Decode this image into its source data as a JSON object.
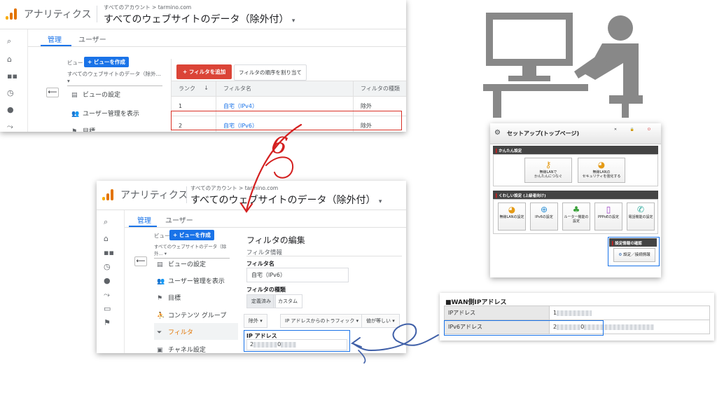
{
  "ga1": {
    "app_title": "アナリティクス",
    "account": "すべてのアカウント > tarmino.com",
    "property": "すべてのウェブサイトのデータ（除外付）",
    "tabs": [
      "管理",
      "ユーザー"
    ],
    "view_label": "ビュー",
    "create_view": "+ ビューを作成",
    "view_select": "すべてのウェブサイトのデータ（除外...",
    "menu": [
      {
        "icon": "file-icon",
        "label": "ビューの設定"
      },
      {
        "icon": "users-icon",
        "label": "ユーザー管理を表示"
      },
      {
        "icon": "flag-icon",
        "label": "目標"
      }
    ],
    "add_filter": "+ フィルタを追加",
    "reorder": "フィルタの順序を割り当て",
    "table": {
      "headers": [
        "ランク",
        "フィルタ名",
        "フィルタの種類"
      ],
      "rows": [
        [
          "1",
          "自宅（IPv4）",
          "除外"
        ],
        [
          "2",
          "自宅（IPv6）",
          "除外"
        ]
      ]
    }
  },
  "ga2": {
    "app_title": "アナリティクス",
    "account": "すべてのアカウント > tarmino.com",
    "property": "すべてのウェブサイトのデータ（除外付）",
    "tabs": [
      "管理",
      "ユーザー"
    ],
    "view_label": "ビュー",
    "create_view": "+ ビューを作成",
    "view_select": "すべてのウェブサイトのデータ（除外...",
    "menu": [
      {
        "icon": "file-icon",
        "label": "ビューの設定"
      },
      {
        "icon": "users-icon",
        "label": "ユーザー管理を表示"
      },
      {
        "icon": "flag-icon",
        "label": "目標"
      },
      {
        "icon": "person-icon",
        "label": "コンテンツ グループ"
      },
      {
        "icon": "filter-icon",
        "label": "フィルタ"
      },
      {
        "icon": "channel-icon",
        "label": "チャネル設定"
      }
    ],
    "edit_title": "フィルタの編集",
    "info_title": "フィルタ情報",
    "filter_name_label": "フィルタ名",
    "filter_name_value": "自宅（IPv6）",
    "filter_type_label": "フィルタの種類",
    "type_tabs": [
      "定義済み",
      "カスタム"
    ],
    "dropdowns": [
      "除外",
      "IP アドレスからのトラフィック",
      "値が等しい"
    ],
    "ip_label": "IP アドレス",
    "ip_value_start": "2",
    "ip_value_mid": "0"
  },
  "annotation_number": "6",
  "router": {
    "title": "セットアップ(トップページ)",
    "section_easy": "かんたん設定",
    "easy_buttons": [
      "無線LANで\nかんたんにつなぐ",
      "無線LANの\nセキュリティを強化する"
    ],
    "section_detail": "くわしい設定 (上級者向け)",
    "detail_buttons": [
      "無線LANの設定",
      "IPv6の設定",
      "ルーター機能の\n設定",
      "PPPoEの設定",
      "電話機能の設定"
    ],
    "section_confirm": "設定情報の確認",
    "confirm_button": "設定／接続情報"
  },
  "wan": {
    "title": "■WAN側IPアドレス",
    "rows": [
      {
        "key": "IPアドレス",
        "value_start": "1"
      },
      {
        "key": "IPv6アドレス",
        "value_start": "2",
        "value_mid": "0"
      }
    ]
  },
  "colors": {
    "ga_blue": "#1a73e8",
    "ga_red": "#db4437",
    "ga_orange": "#e37400",
    "arrow_red": "#d42020",
    "arrow_blue": "#4060a8",
    "illustration_gray": "#888888"
  }
}
